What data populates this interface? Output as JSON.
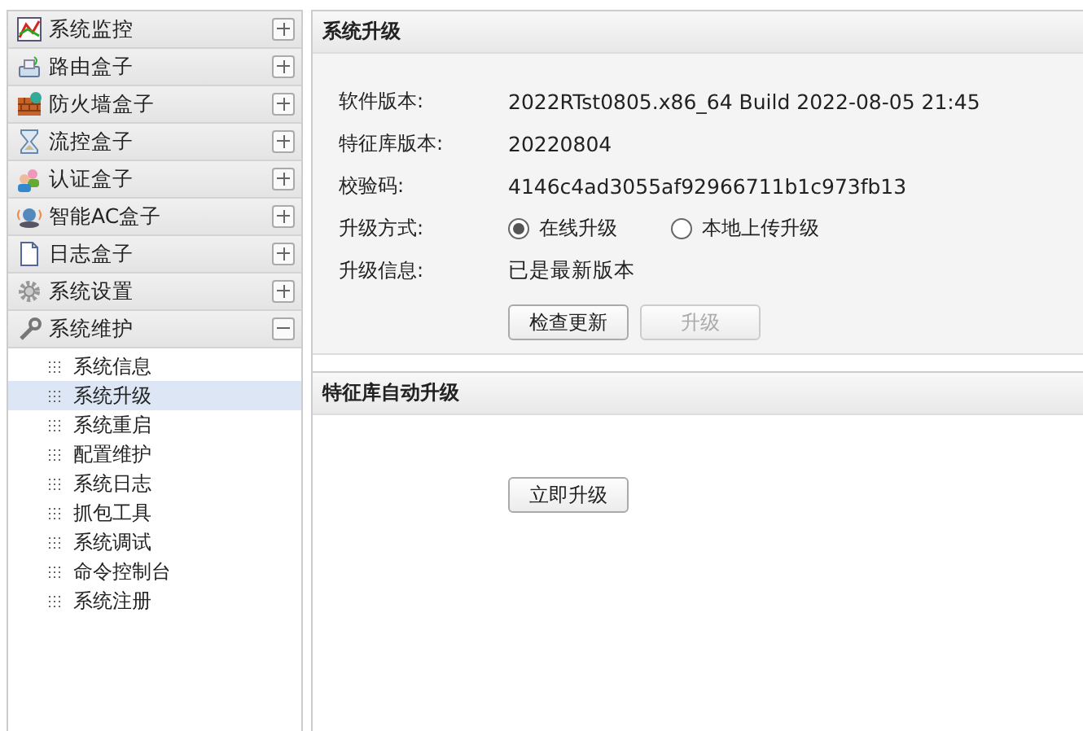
{
  "sidebar": {
    "groups": [
      {
        "label": "系统监控",
        "expanded": false
      },
      {
        "label": "路由盒子",
        "expanded": false
      },
      {
        "label": "防火墙盒子",
        "expanded": false
      },
      {
        "label": "流控盒子",
        "expanded": false
      },
      {
        "label": "认证盒子",
        "expanded": false
      },
      {
        "label": "智能AC盒子",
        "expanded": false
      },
      {
        "label": "日志盒子",
        "expanded": false
      },
      {
        "label": "系统设置",
        "expanded": false
      },
      {
        "label": "系统维护",
        "expanded": true,
        "children": [
          {
            "label": "系统信息",
            "selected": false
          },
          {
            "label": "系统升级",
            "selected": true
          },
          {
            "label": "系统重启",
            "selected": false
          },
          {
            "label": "配置维护",
            "selected": false
          },
          {
            "label": "系统日志",
            "selected": false
          },
          {
            "label": "抓包工具",
            "selected": false
          },
          {
            "label": "系统调试",
            "selected": false
          },
          {
            "label": "命令控制台",
            "selected": false
          },
          {
            "label": "系统注册",
            "selected": false
          }
        ]
      }
    ]
  },
  "panels": [
    {
      "title": "系统升级",
      "fields": [
        {
          "kind": "text",
          "label": "软件版本:",
          "value": "2022RTst0805.x86_64 Build 2022-08-05 21:45"
        },
        {
          "kind": "text",
          "label": "特征库版本:",
          "value": "20220804"
        },
        {
          "kind": "text",
          "label": "校验码:",
          "value": "4146c4ad3055af92966711b1c973fb13"
        },
        {
          "kind": "radio",
          "label": "升级方式:",
          "options": [
            {
              "label": "在线升级",
              "selected": true
            },
            {
              "label": "本地上传升级",
              "selected": false
            }
          ]
        },
        {
          "kind": "text",
          "label": "升级信息:",
          "value": "已是最新版本"
        }
      ],
      "buttons": [
        {
          "label": "检查更新",
          "disabled": false
        },
        {
          "label": "升级",
          "disabled": true
        }
      ]
    },
    {
      "title": "特征库自动升级",
      "buttons": [
        {
          "label": "立即升级",
          "disabled": false
        }
      ]
    }
  ]
}
